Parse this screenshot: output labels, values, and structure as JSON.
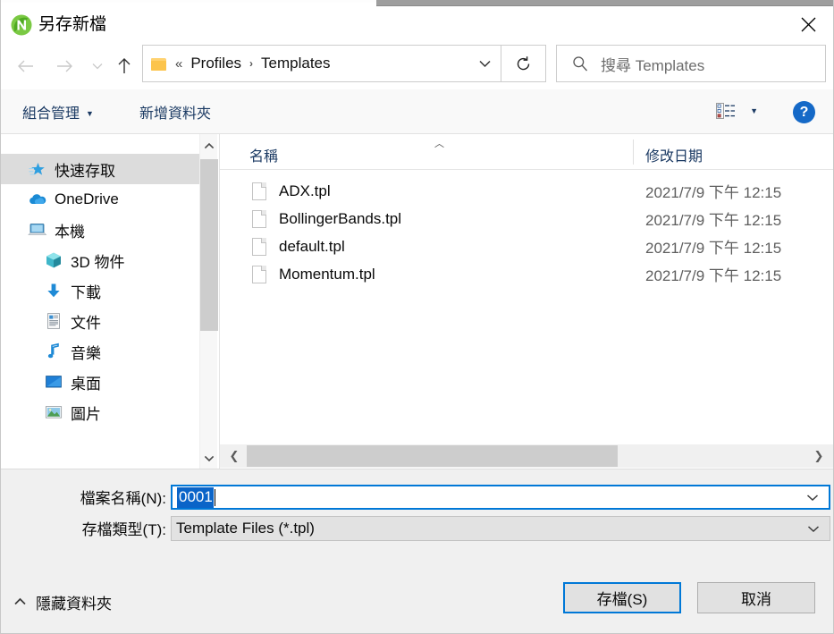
{
  "window": {
    "title": "另存新檔",
    "app_icon": "ninja-logo-icon",
    "close_label": "✕"
  },
  "navbar": {
    "back_icon": "arrow-left-icon",
    "forward_icon": "arrow-right-icon",
    "recent_icon": "chevron-down-icon",
    "up_icon": "arrow-up-icon",
    "folder_icon": "folder-icon",
    "breadcrumb_prefix": "«",
    "breadcrumb": [
      {
        "label": "Profiles",
        "separator": "›"
      },
      {
        "label": "Templates",
        "separator": ""
      }
    ],
    "dropdown_icon": "chevron-down-icon",
    "refresh_icon": "↻",
    "search": {
      "icon": "search-icon",
      "placeholder": "搜尋 Templates",
      "value": ""
    }
  },
  "toolbar": {
    "organize_label": "組合管理",
    "organize_caret": "▼",
    "new_folder_label": "新增資料夾",
    "view_icon": "list-view-icon",
    "view_caret": "▼",
    "help_label": "?"
  },
  "nav_pane": {
    "items": [
      {
        "label": "快速存取",
        "icon": "pin-star-icon",
        "indent": "np-l0",
        "selected": true
      },
      {
        "label": "OneDrive",
        "icon": "onedrive-cloud-icon",
        "indent": "np-l1",
        "selected": false
      },
      {
        "label": "本機",
        "icon": "this-pc-icon",
        "indent": "np-l1",
        "selected": false
      },
      {
        "label": "3D 物件",
        "icon": "3d-objects-icon",
        "indent": "np-l2",
        "selected": false
      },
      {
        "label": "下載",
        "icon": "downloads-icon",
        "indent": "np-l2",
        "selected": false
      },
      {
        "label": "文件",
        "icon": "documents-icon",
        "indent": "np-l2",
        "selected": false
      },
      {
        "label": "音樂",
        "icon": "music-icon",
        "indent": "np-l2",
        "selected": false
      },
      {
        "label": "桌面",
        "icon": "desktop-icon",
        "indent": "np-l2",
        "selected": false
      },
      {
        "label": "圖片",
        "icon": "pictures-icon",
        "indent": "np-l2",
        "selected": false
      }
    ],
    "scroll_up_icon": "chevron-up-icon",
    "scroll_down_icon": "chevron-down-icon"
  },
  "file_list": {
    "columns": {
      "name": "名稱",
      "date": "修改日期"
    },
    "sort_caret": "︿",
    "rows": [
      {
        "name": "ADX.tpl",
        "date": "2021/7/9 下午 12:15"
      },
      {
        "name": "BollingerBands.tpl",
        "date": "2021/7/9 下午 12:15"
      },
      {
        "name": "default.tpl",
        "date": "2021/7/9 下午 12:15"
      },
      {
        "name": "Momentum.tpl",
        "date": "2021/7/9 下午 12:15"
      }
    ],
    "h_scroll_left_icon": "❮",
    "h_scroll_right_icon": "❯"
  },
  "form": {
    "filename_label": "檔案名稱(N):",
    "filename_value": "0001",
    "filetype_label": "存檔類型(T):",
    "filetype_value": "Template Files (*.tpl)",
    "combo_arrow": "⌄"
  },
  "footer": {
    "hide_folders_caret": "︿",
    "hide_folders_label": "隱藏資料夾",
    "save_label": "存檔(S)",
    "cancel_label": "取消"
  },
  "colors": {
    "accent": "#0078d7",
    "selection": "#0a64c8",
    "help_blue": "#1569c7",
    "link_text": "#1b3a63",
    "panel_bg": "#f0f0f0"
  }
}
